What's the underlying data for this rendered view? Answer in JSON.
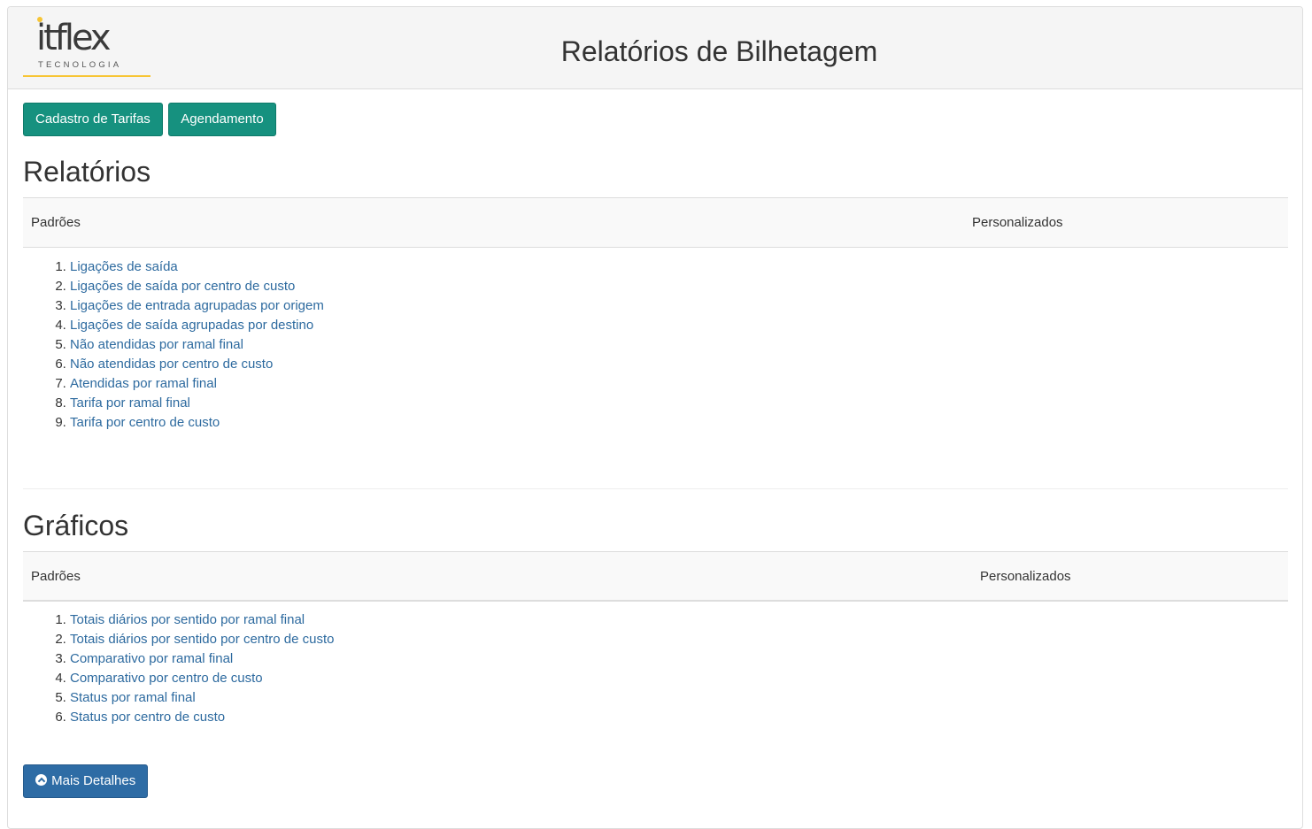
{
  "header": {
    "logo_word": "itflex",
    "logo_sub": "TECNOLOGIA",
    "title": "Relatórios de Bilhetagem"
  },
  "toolbar": {
    "tarifas_label": "Cadastro de Tarifas",
    "agendamento_label": "Agendamento"
  },
  "relatorios": {
    "title": "Relatórios",
    "col_padroes": "Padrões",
    "col_personalizados": "Personalizados",
    "items": [
      "Ligações de saída",
      "Ligações de saída por centro de custo",
      "Ligações de entrada agrupadas por origem",
      "Ligações de saída agrupadas por destino",
      "Não atendidas por ramal final",
      "Não atendidas por centro de custo",
      "Atendidas por ramal final",
      "Tarifa por ramal final",
      "Tarifa por centro de custo"
    ]
  },
  "graficos": {
    "title": "Gráficos",
    "col_padroes": "Padrões",
    "col_personalizados": "Personalizados",
    "items": [
      "Totais diários por sentido por ramal final",
      "Totais diários por sentido por centro de custo",
      "Comparativo por ramal final",
      "Comparativo por centro de custo",
      "Status por ramal final",
      "Status por centro de custo"
    ]
  },
  "footer": {
    "details_label": "Mais Detalhes",
    "details_icon": "chevron-circle-up-icon"
  },
  "colors": {
    "accent_teal": "#16917f",
    "accent_blue": "#2e6ca5",
    "link": "#2d6a9f",
    "logo_yellow": "#f7c535"
  }
}
